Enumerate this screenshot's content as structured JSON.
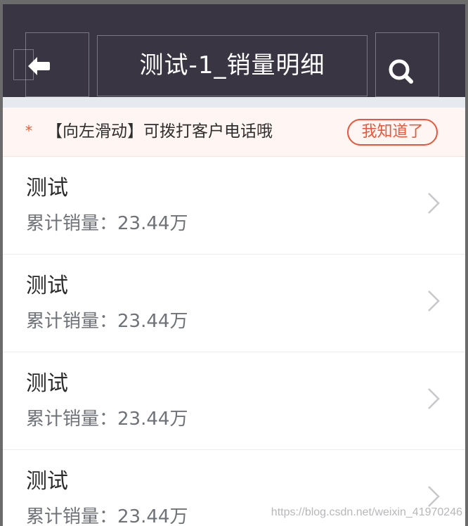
{
  "header": {
    "title": "测试-1_销量明细",
    "back_icon": "arrow-left-icon",
    "search_icon": "search-icon"
  },
  "notice": {
    "marker": "*",
    "text": "【向左滑动】可拨打客户电话哦",
    "button_label": "我知道了",
    "accent_color": "#e8573a"
  },
  "items": [
    {
      "name": "测试",
      "sales_label": "累计销量：",
      "sales_value": "23.44万"
    },
    {
      "name": "测试",
      "sales_label": "累计销量：",
      "sales_value": "23.44万"
    },
    {
      "name": "测试",
      "sales_label": "累计销量：",
      "sales_value": "23.44万"
    },
    {
      "name": "测试",
      "sales_label": "累计销量：",
      "sales_value": "23.44万"
    }
  ],
  "watermark": "https://blog.csdn.net/weixin_41970246",
  "colors": {
    "header_bg": "#393542",
    "page_bg": "#ffffff",
    "notice_bg": "#fff5f2"
  }
}
